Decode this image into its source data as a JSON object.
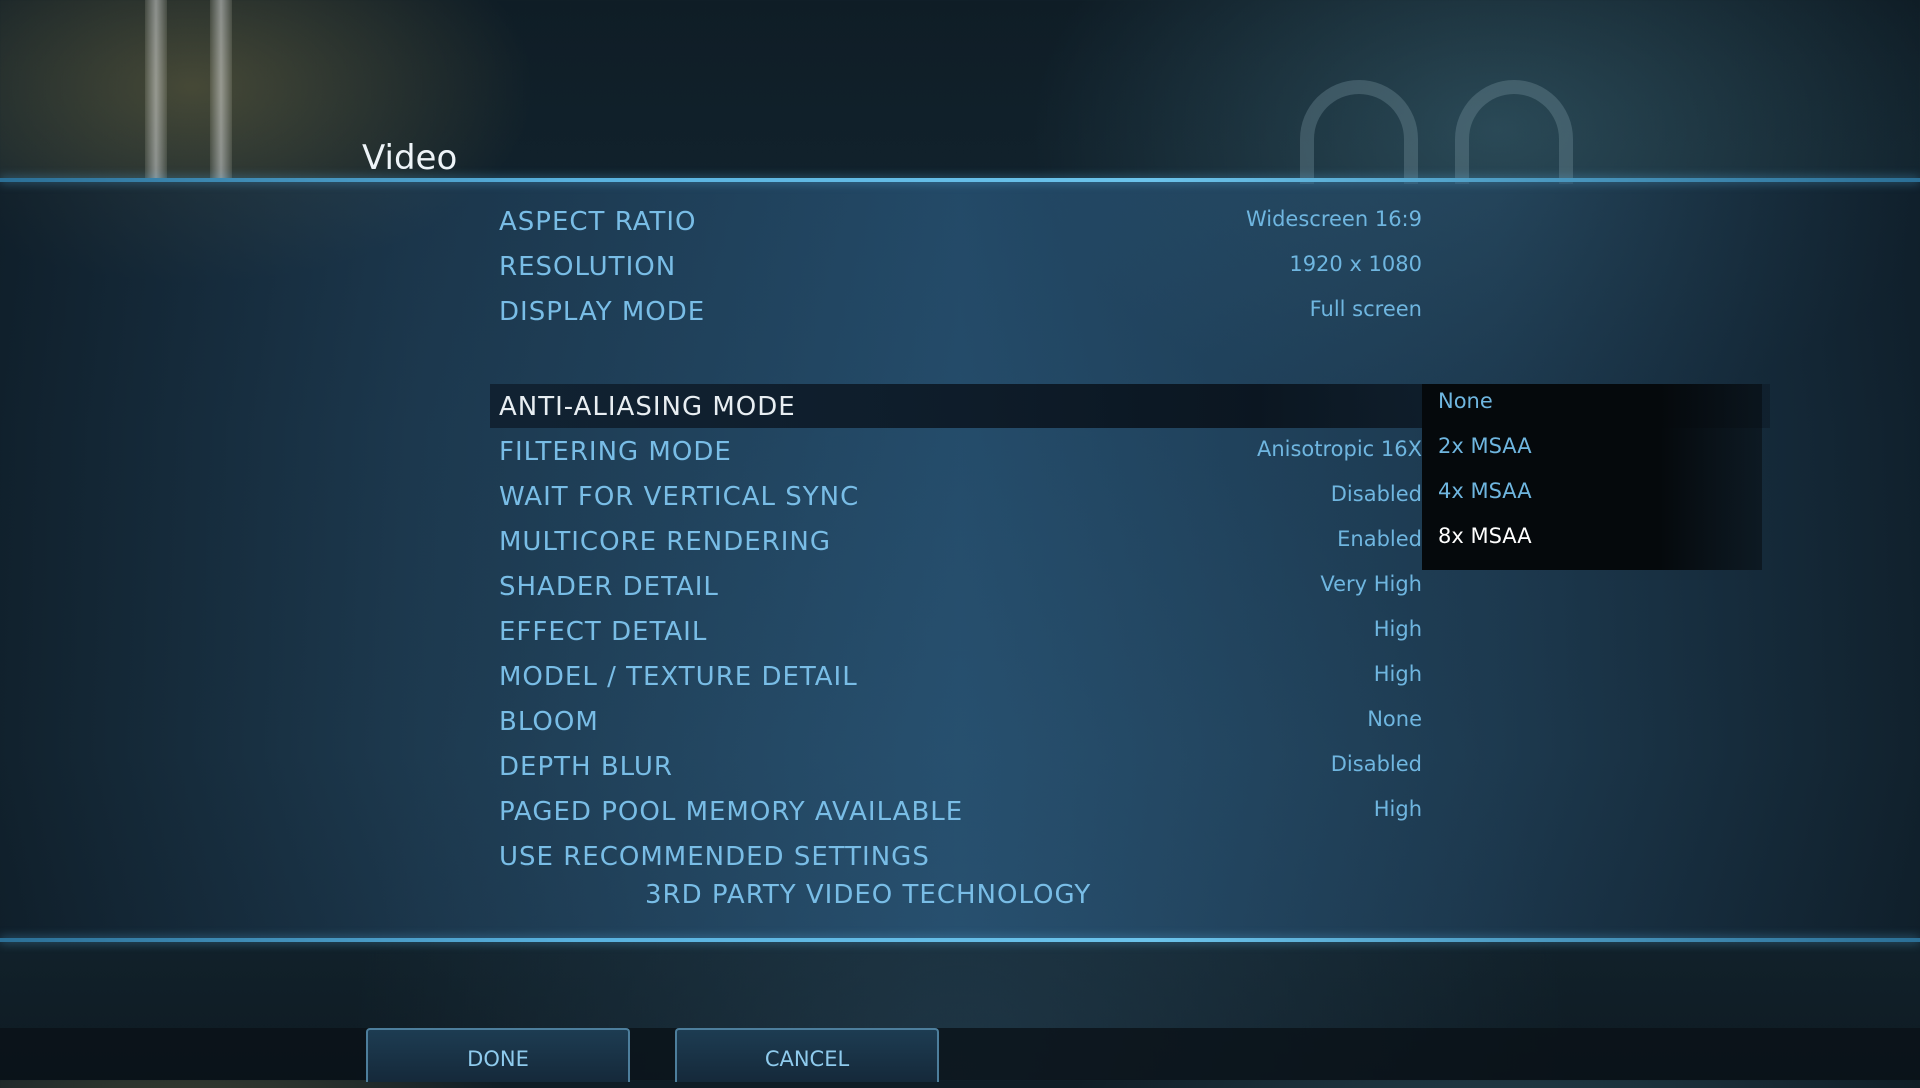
{
  "page": {
    "title": "Video"
  },
  "settings": [
    {
      "label": "ASPECT RATIO",
      "value": "Widescreen 16:9"
    },
    {
      "label": "RESOLUTION",
      "value": "1920 x 1080"
    },
    {
      "label": "DISPLAY MODE",
      "value": "Full screen"
    },
    {
      "label": "ANTI-ALIASING MODE",
      "value": ""
    },
    {
      "label": "FILTERING MODE",
      "value": "Anisotropic 16X"
    },
    {
      "label": "WAIT FOR VERTICAL SYNC",
      "value": "Disabled"
    },
    {
      "label": "MULTICORE RENDERING",
      "value": "Enabled"
    },
    {
      "label": "SHADER DETAIL",
      "value": "Very High"
    },
    {
      "label": "EFFECT DETAIL",
      "value": "High"
    },
    {
      "label": "MODEL / TEXTURE DETAIL",
      "value": "High"
    },
    {
      "label": "BLOOM",
      "value": "None"
    },
    {
      "label": "DEPTH BLUR",
      "value": "Disabled"
    },
    {
      "label": "PAGED POOL MEMORY AVAILABLE",
      "value": "High"
    },
    {
      "label": "USE RECOMMENDED SETTINGS",
      "value": ""
    }
  ],
  "third_party": "3RD PARTY VIDEO TECHNOLOGY",
  "dropdown": {
    "options": [
      "None",
      "2x MSAA",
      "4x MSAA",
      "8x MSAA"
    ],
    "highlighted": "8x MSAA"
  },
  "buttons": {
    "done": "DONE",
    "cancel": "CANCEL"
  }
}
